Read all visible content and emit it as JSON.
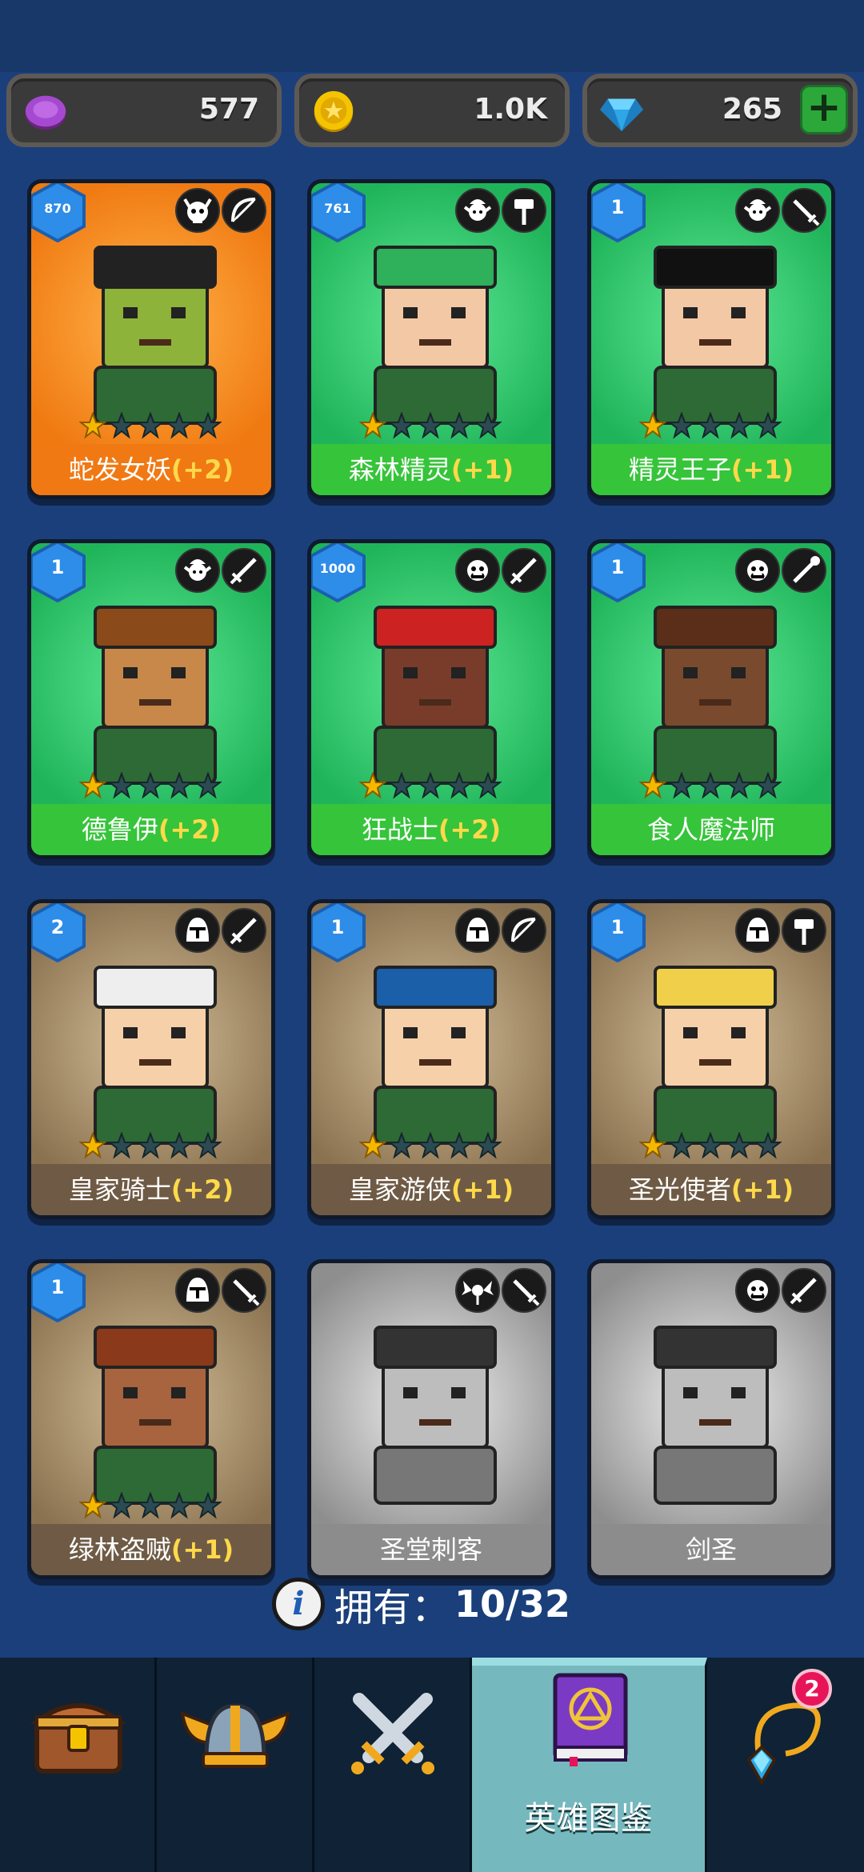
{
  "currencies": [
    {
      "name": "purple-token",
      "value": "577",
      "color": "#9b44c9"
    },
    {
      "name": "gold-coin",
      "value": "1.0K",
      "color": "#f5c400"
    },
    {
      "name": "gem",
      "value": "265",
      "color": "#2aa9e6"
    }
  ],
  "heroes": [
    {
      "level": "870",
      "name": "蛇发女妖",
      "bonus": "(+2)",
      "theme": "orange",
      "stars": 1,
      "race_icon": "demon-skull-icon",
      "class_icon": "bow-icon"
    },
    {
      "level": "761",
      "name": "森林精灵",
      "bonus": "(+1)",
      "theme": "green",
      "stars": 1,
      "race_icon": "elf-icon",
      "class_icon": "hammer-icon"
    },
    {
      "level": "1",
      "name": "精灵王子",
      "bonus": "(+1)",
      "theme": "green",
      "stars": 1,
      "race_icon": "elf-icon",
      "class_icon": "dagger-icon"
    },
    {
      "level": "1",
      "name": "德鲁伊",
      "bonus": "(+2)",
      "theme": "green",
      "stars": 1,
      "race_icon": "elf-icon",
      "class_icon": "sword-icon"
    },
    {
      "level": "1000",
      "name": "狂战士",
      "bonus": "(+2)",
      "theme": "green",
      "stars": 1,
      "race_icon": "orc-icon",
      "class_icon": "sword-icon"
    },
    {
      "level": "1",
      "name": "食人魔法师",
      "bonus": "",
      "theme": "green",
      "stars": 1,
      "race_icon": "orc-icon",
      "class_icon": "staff-icon"
    },
    {
      "level": "2",
      "name": "皇家骑士",
      "bonus": "(+2)",
      "theme": "brown",
      "stars": 1,
      "race_icon": "helmet-icon",
      "class_icon": "sword-icon"
    },
    {
      "level": "1",
      "name": "皇家游侠",
      "bonus": "(+1)",
      "theme": "brown",
      "stars": 1,
      "race_icon": "helmet-icon",
      "class_icon": "bow-icon"
    },
    {
      "level": "1",
      "name": "圣光使者",
      "bonus": "(+1)",
      "theme": "brown",
      "stars": 1,
      "race_icon": "helmet-icon",
      "class_icon": "hammer-icon"
    },
    {
      "level": "1",
      "name": "绿林盗贼",
      "bonus": "(+1)",
      "theme": "brown",
      "stars": 1,
      "race_icon": "helmet-icon",
      "class_icon": "dagger-icon"
    },
    {
      "level": "",
      "name": "圣堂刺客",
      "bonus": "",
      "theme": "grey",
      "stars": 0,
      "race_icon": "winged-emblem-icon",
      "class_icon": "dagger-icon"
    },
    {
      "level": "",
      "name": "剑圣",
      "bonus": "",
      "theme": "grey",
      "stars": 0,
      "race_icon": "orc-icon",
      "class_icon": "sword-icon"
    }
  ],
  "owned": {
    "label": "拥有：",
    "count": "10/32"
  },
  "nav": {
    "items": [
      {
        "name": "chest-icon"
      },
      {
        "name": "viking-helmet-icon"
      },
      {
        "name": "crossed-swords-icon"
      },
      {
        "name": "spellbook-icon",
        "label": "英雄图鉴",
        "active": true
      },
      {
        "name": "amulet-icon",
        "badge": "2"
      }
    ]
  }
}
